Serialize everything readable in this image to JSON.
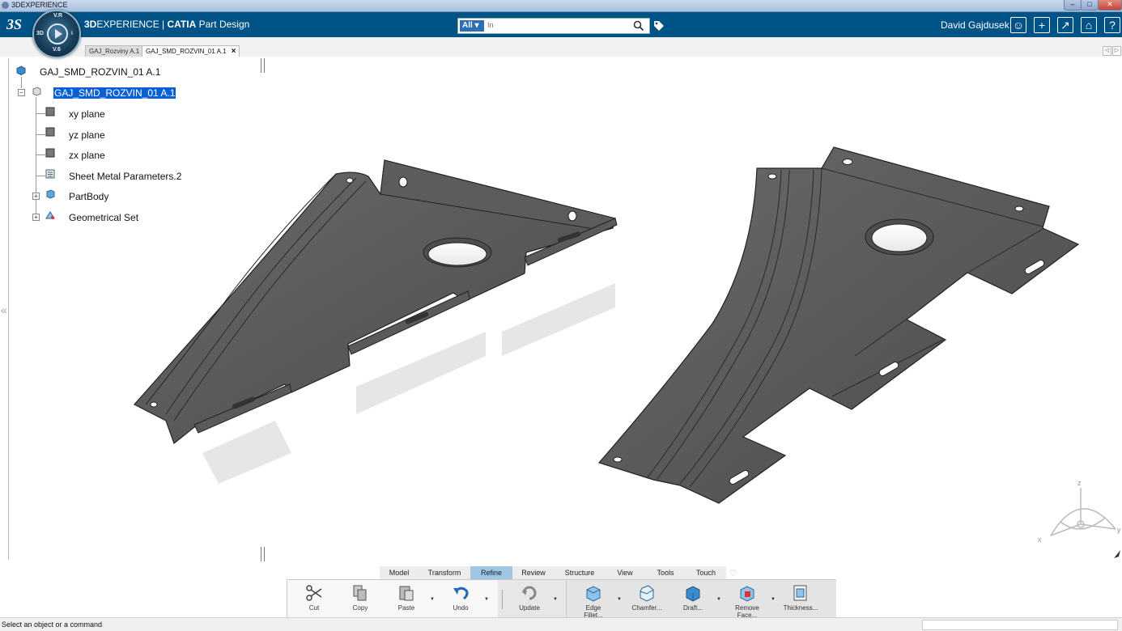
{
  "window": {
    "title": "3DEXPERIENCE",
    "min": "–",
    "max": "□",
    "close": "✕"
  },
  "header": {
    "logo": "3S",
    "compass_labels": {
      "top": "V.R",
      "left": "3D",
      "right": "i",
      "bottom": "V.6"
    },
    "brand_prefix": "3D",
    "brand_rest": "EXPERIENCE | ",
    "brand_app": "CATIA",
    "brand_module": " Part Design",
    "search": {
      "scope": "All ▾",
      "placeholder": "In"
    },
    "user": "David Gajdusek",
    "buttons": [
      "user-icon",
      "plus-icon",
      "share-icon",
      "home-icon",
      "help-icon"
    ],
    "button_glyphs": {
      "plus": "+",
      "share": "↗",
      "home": "⌂",
      "help": "?",
      "user": "☺"
    }
  },
  "tabs": [
    {
      "label": "GAJ_Rozviny A.1"
    },
    {
      "label": "GAJ_SMD_ROZVIN_01 A.1",
      "close": "×"
    }
  ],
  "tab_scroll": {
    "left": "◁",
    "right": "▷"
  },
  "tree": {
    "root": "GAJ_SMD_ROZVIN_01 A.1",
    "part": "GAJ_SMD_ROZVIN_01 A.1",
    "children": [
      "xy plane",
      "yz plane",
      "zx plane",
      "Sheet Metal Parameters.2",
      "PartBody",
      "Geometrical Set"
    ],
    "expand_glyph": "+",
    "collapse_glyph": "−"
  },
  "collapse_panel": "«",
  "compass_axes": {
    "x": "x",
    "y": "y",
    "z": "z"
  },
  "section_tabs": [
    "Model",
    "Transform",
    "Refine",
    "Review",
    "Structure",
    "View",
    "Tools",
    "Touch"
  ],
  "active_section": "Refine",
  "pin_glyph": "♡",
  "toolbar": {
    "cut": "Cut",
    "copy": "Copy",
    "paste": "Paste",
    "undo": "Undo",
    "update": "Update",
    "edge_fillet": "Edge Fillet...",
    "chamfer": "Chamfer...",
    "draft": "Draft...",
    "remove_face": "Remove Face...",
    "thickness": "Thickness...",
    "dropdown": "▼"
  },
  "status": {
    "message": "Select an object or a command"
  },
  "colors": {
    "header_bg": "#005386",
    "active_tab": "#9fc7e3",
    "selection": "#0a5fd6",
    "part": "#555555"
  }
}
